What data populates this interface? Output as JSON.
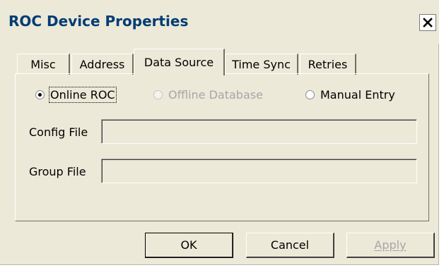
{
  "window": {
    "title": "ROC Device Properties",
    "close_label": "×"
  },
  "tabs": [
    {
      "label": "Misc",
      "active": false
    },
    {
      "label": "Address",
      "active": false
    },
    {
      "label": "Data Source",
      "active": true
    },
    {
      "label": "Time Sync",
      "active": false
    },
    {
      "label": "Retries",
      "active": false
    }
  ],
  "data_source": {
    "options": [
      {
        "label": "Online ROC",
        "checked": true,
        "enabled": true
      },
      {
        "label": "Offline Database",
        "checked": false,
        "enabled": false
      },
      {
        "label": "Manual Entry",
        "checked": false,
        "enabled": true
      }
    ],
    "config_file": {
      "label": "Config File",
      "value": ""
    },
    "group_file": {
      "label": "Group File",
      "value": ""
    }
  },
  "buttons": {
    "ok": "OK",
    "cancel": "Cancel",
    "apply": "Apply"
  },
  "colors": {
    "dialog_bg": "#ece9d8",
    "title_text": "#003c74",
    "disabled_text": "#a7a6aa"
  }
}
